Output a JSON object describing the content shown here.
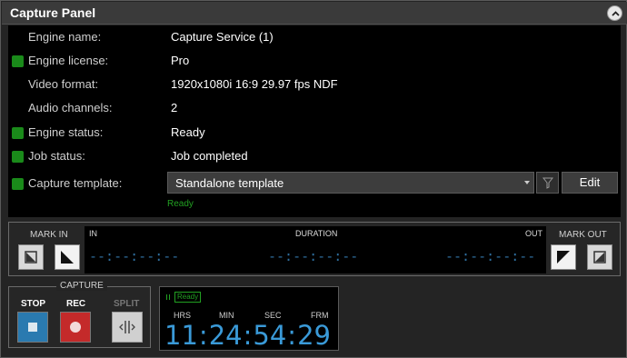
{
  "panel": {
    "title": "Capture Panel"
  },
  "info": {
    "rows": [
      {
        "label": "Engine name:",
        "value": "Capture Service (1)",
        "led": false
      },
      {
        "label": "Engine license:",
        "value": "Pro",
        "led": true
      },
      {
        "label": "Video format:",
        "value": "1920x1080i 16:9 29.97 fps NDF",
        "led": false
      },
      {
        "label": "Audio channels:",
        "value": "2",
        "led": false
      },
      {
        "label": "Engine status:",
        "value": "Ready",
        "led": true
      },
      {
        "label": "Job status:",
        "value": "Job completed",
        "led": true
      }
    ],
    "template_label": "Capture template:",
    "template_value": "Standalone template",
    "template_status": "Ready",
    "edit_label": "Edit",
    "led_color": "#1a8a1a"
  },
  "marks": {
    "mark_in_label": "MARK IN",
    "mark_out_label": "MARK OUT",
    "in_label": "IN",
    "duration_label": "DURATION",
    "out_label": "OUT",
    "in_tc": "--:--:--:--",
    "duration_tc": "--:--:--:--",
    "out_tc": "--:--:--:--"
  },
  "capture": {
    "legend": "CAPTURE",
    "stop_label": "STOP",
    "rec_label": "REC",
    "split_label": "SPLIT",
    "stop_color": "#2a7ab0",
    "rec_color": "#c42a2a"
  },
  "clock": {
    "status": "Ready",
    "hrs_label": "HRS",
    "min_label": "MIN",
    "sec_label": "SEC",
    "frm_label": "FRM",
    "hrs": "11",
    "min": "24",
    "sec": "54",
    "frm": "29"
  }
}
